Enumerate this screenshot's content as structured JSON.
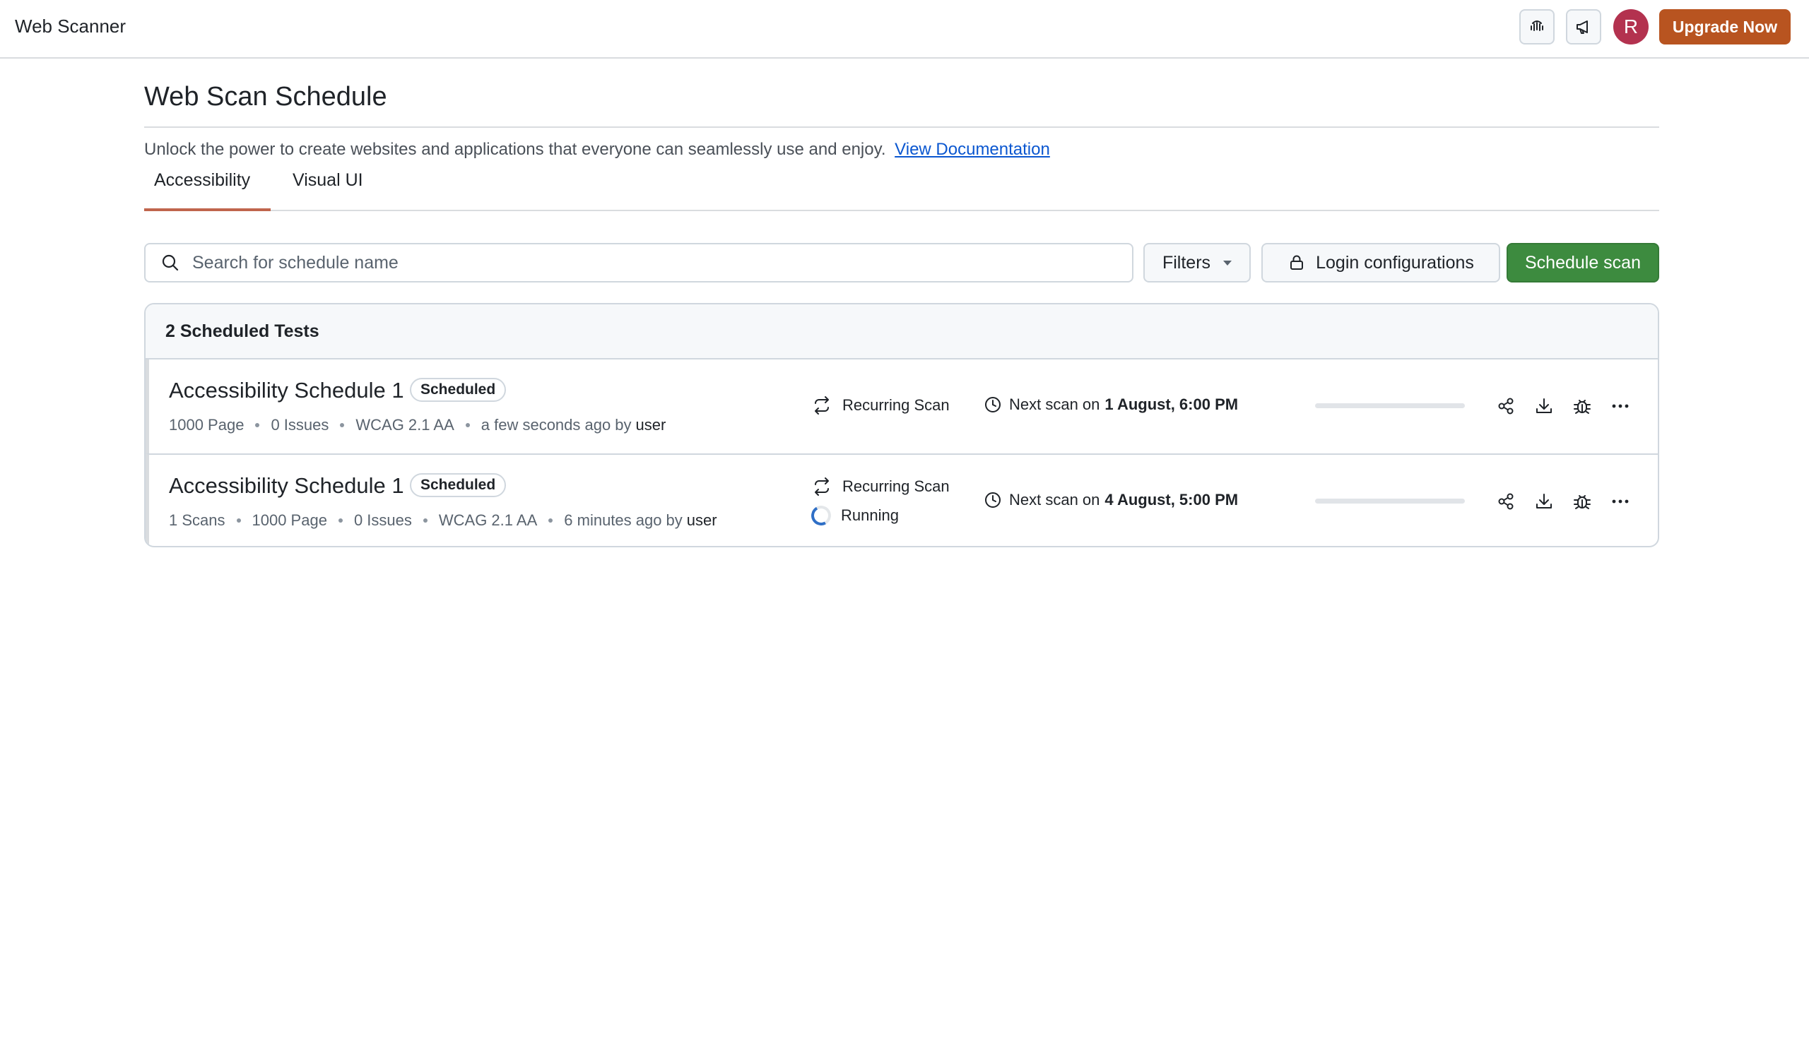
{
  "app": {
    "title": "Web Scanner"
  },
  "header": {
    "icons": [
      "accessibility-wave-icon",
      "megaphone-icon"
    ],
    "avatar_initial": "R",
    "upgrade_label": "Upgrade Now",
    "upgrade_color": "#b85420"
  },
  "page": {
    "title": "Web Scan Schedule",
    "description": "Unlock the power to create websites and applications that everyone can seamlessly use and enjoy.",
    "doc_link": "View Documentation"
  },
  "tabs": [
    {
      "label": "Accessibility",
      "active": true
    },
    {
      "label": "Visual UI",
      "active": false
    }
  ],
  "toolbar": {
    "search_placeholder": "Search for schedule name",
    "filters_label": "Filters",
    "login_label": "Login configurations",
    "schedule_label": "Schedule scan",
    "schedule_color": "#3d8b3f"
  },
  "list": {
    "header": "2 Scheduled Tests",
    "rows": [
      {
        "name": "Accessibility Schedule 1",
        "badge": "Scheduled",
        "meta": [
          "1000 Page",
          "0 Issues",
          "WCAG 2.1 AA"
        ],
        "time": "a few seconds ago",
        "by": "by",
        "user": "user",
        "type": "Recurring Scan",
        "next_label": "Next scan on",
        "next_date": "1 August, 6:00 PM",
        "progress": 0
      },
      {
        "name": "Accessibility Schedule 1",
        "badge": "Scheduled",
        "meta": [
          "1 Scans",
          "1000 Page",
          "0 Issues",
          "WCAG 2.1 AA"
        ],
        "time": "6 minutes ago",
        "by": "by",
        "user": "user",
        "type": "Recurring Scan",
        "status": "Running",
        "next_label": "Next scan on",
        "next_date": "4 August, 5:00 PM",
        "progress": 0
      }
    ]
  }
}
